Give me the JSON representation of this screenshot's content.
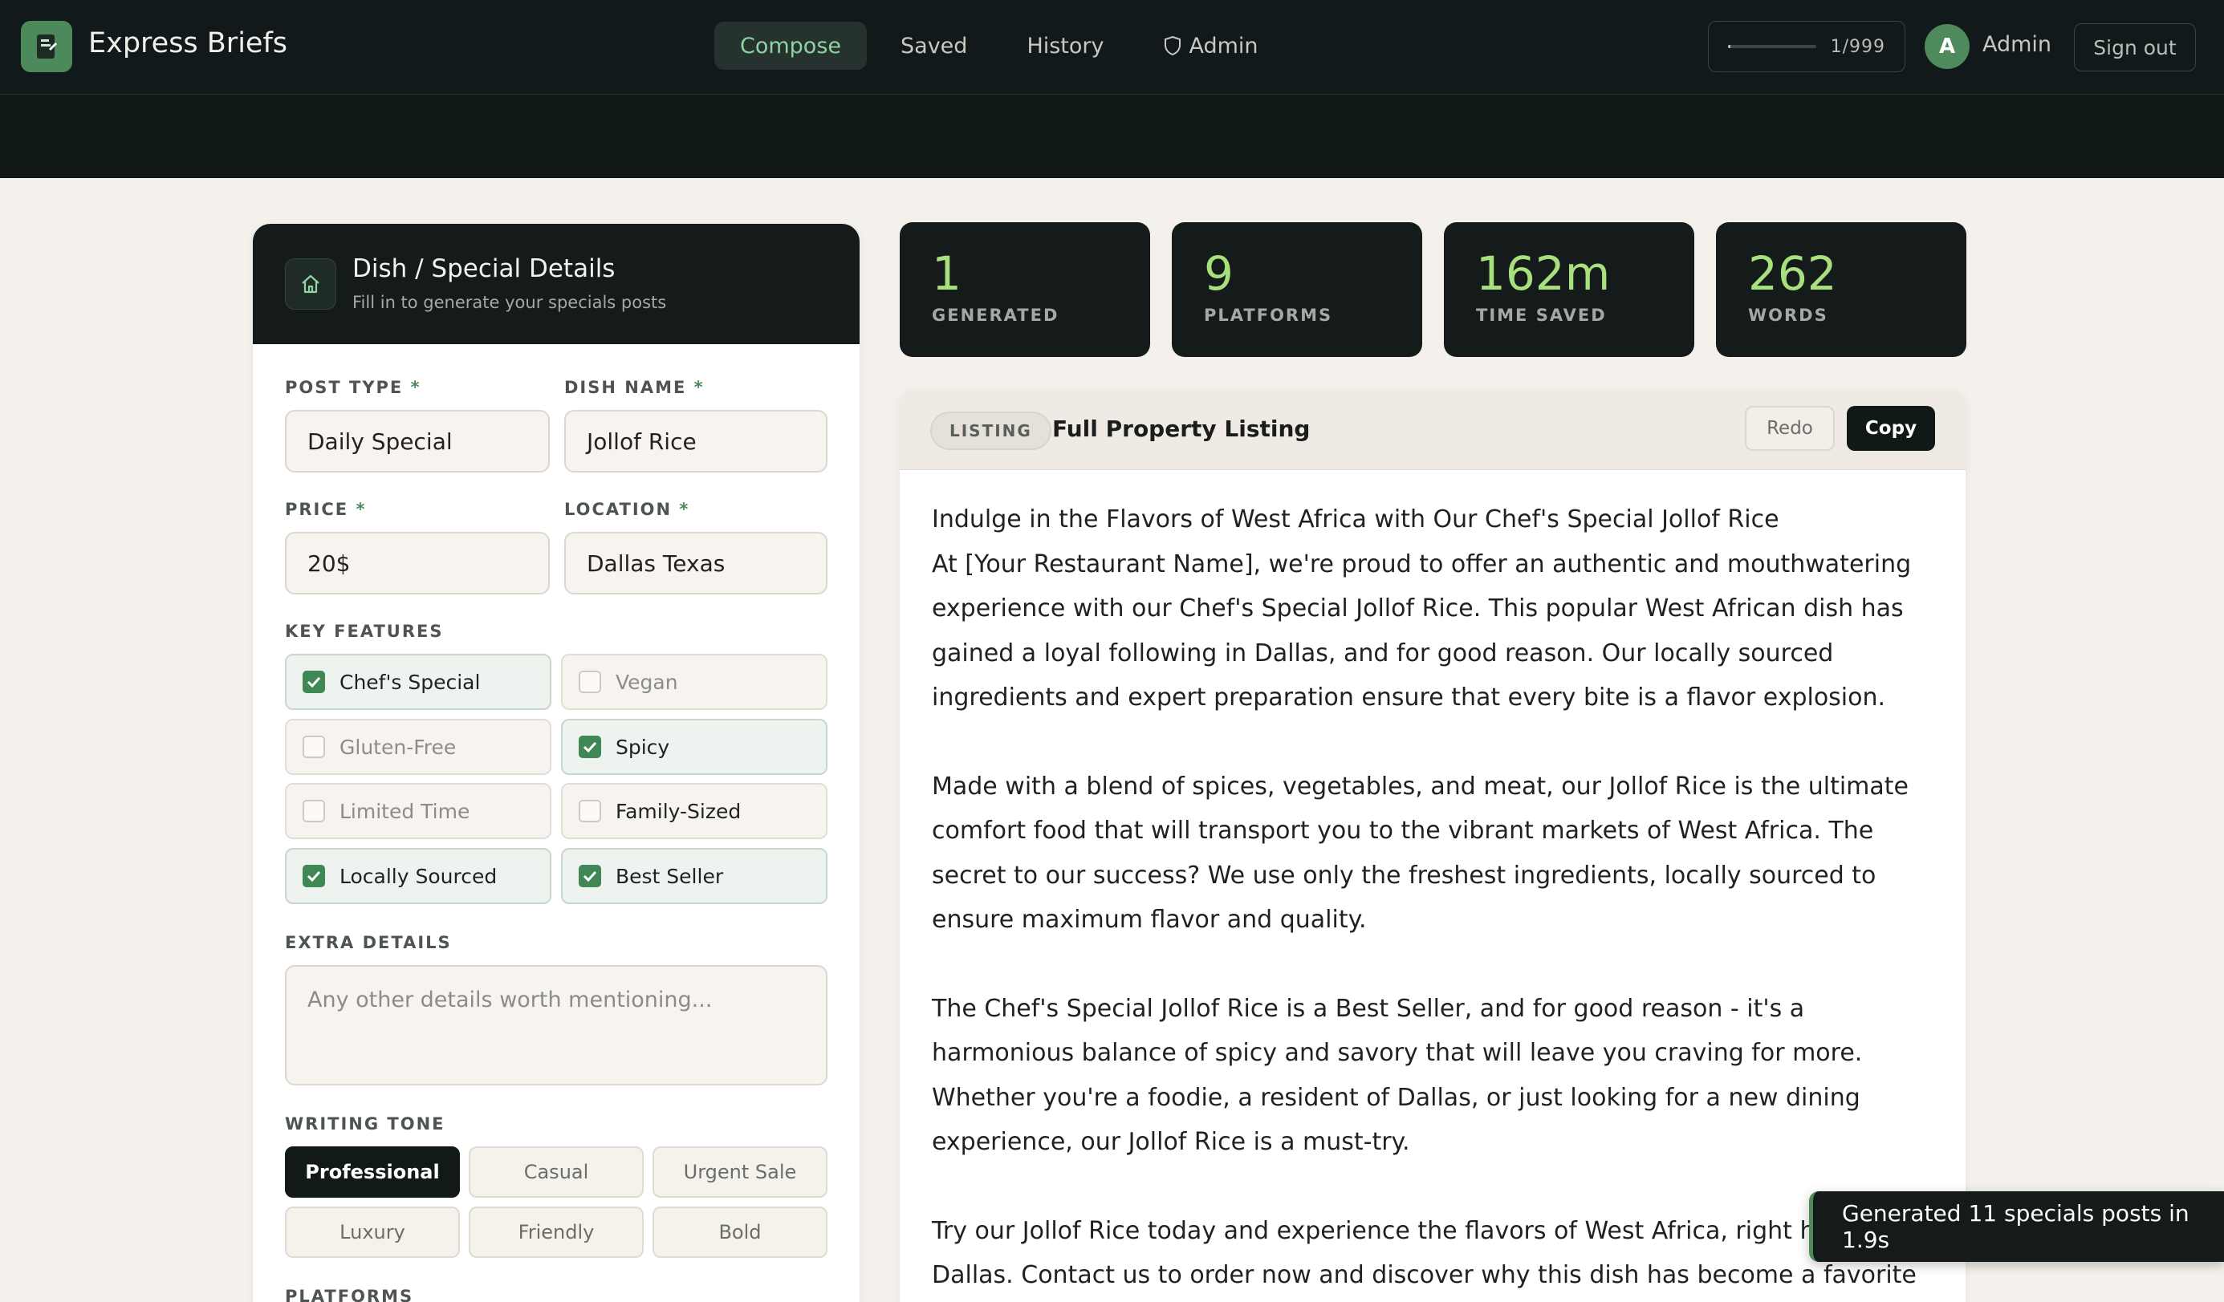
{
  "app": {
    "title": "Express Briefs"
  },
  "nav": {
    "tabs": [
      {
        "label": "Compose",
        "active": true
      },
      {
        "label": "Saved",
        "active": false
      },
      {
        "label": "History",
        "active": false
      },
      {
        "label": "Admin",
        "active": false,
        "icon": "shield-icon"
      }
    ]
  },
  "usage": {
    "text": "1/999",
    "fraction": 0.001
  },
  "user": {
    "initial": "A",
    "name": "Admin"
  },
  "signout_label": "Sign out",
  "form": {
    "title": "Dish / Special Details",
    "subtitle": "Fill in to generate your specials posts",
    "post_type": {
      "label": "POST TYPE",
      "required": "*",
      "value": "Daily Special"
    },
    "dish_name": {
      "label": "DISH NAME",
      "required": "*",
      "value": "Jollof Rice"
    },
    "price": {
      "label": "PRICE",
      "required": "*",
      "value": "20$"
    },
    "location": {
      "label": "LOCATION",
      "required": "*",
      "value": "Dallas Texas"
    },
    "features_label": "KEY FEATURES",
    "features": [
      {
        "label": "Chef's Special",
        "checked": true
      },
      {
        "label": "Vegan",
        "checked": false
      },
      {
        "label": "Gluten-Free",
        "checked": false
      },
      {
        "label": "Spicy",
        "checked": true
      },
      {
        "label": "Limited Time",
        "checked": false
      },
      {
        "label": "Family-Sized",
        "checked": false
      },
      {
        "label": "Locally Sourced",
        "checked": true
      },
      {
        "label": "Best Seller",
        "checked": true
      }
    ],
    "extra_label": "EXTRA DETAILS",
    "extra_placeholder": "Any other details worth mentioning...",
    "tone_label": "WRITING TONE",
    "tones": [
      {
        "label": "Professional",
        "active": true
      },
      {
        "label": "Casual",
        "active": false
      },
      {
        "label": "Urgent Sale",
        "active": false
      },
      {
        "label": "Luxury",
        "active": false
      },
      {
        "label": "Friendly",
        "active": false
      },
      {
        "label": "Bold",
        "active": false
      }
    ],
    "platforms_label": "PLATFORMS"
  },
  "stats": [
    {
      "value": "1",
      "label": "GENERATED"
    },
    {
      "value": "9",
      "label": "PLATFORMS"
    },
    {
      "value": "162m",
      "label": "TIME SAVED"
    },
    {
      "value": "262",
      "label": "WORDS"
    }
  ],
  "result": {
    "badge": "LISTING",
    "title": "Full Property Listing",
    "redo_label": "Redo",
    "copy_label": "Copy",
    "paragraphs": [
      "Indulge in the Flavors of West Africa with Our Chef's Special Jollof Rice\nAt [Your Restaurant Name], we're proud to offer an authentic and mouthwatering experience with our Chef's Special Jollof Rice. This popular West African dish has gained a loyal following in Dallas, and for good reason. Our locally sourced ingredients and expert preparation ensure that every bite is a flavor explosion.",
      "Made with a blend of spices, vegetables, and meat, our Jollof Rice is the ultimate comfort food that will transport you to the vibrant markets of West Africa. The secret to our success? We use only the freshest ingredients, locally sourced to ensure maximum flavor and quality.",
      "The Chef's Special Jollof Rice is a Best Seller, and for good reason - it's a harmonious balance of spicy and savory that will leave you craving for more. Whether you're a foodie, a resident of Dallas, or just looking for a new dining experience, our Jollof Rice is a must-try.",
      "Try our Jollof Rice today and experience the flavors of West Africa, right h\nDallas. Contact us to order now and discover why this dish has become a favorite"
    ]
  },
  "toast": {
    "text": "Generated 11 specials posts in 1.9s"
  },
  "colors": {
    "accent": "#4f8a5d",
    "stat_value": "#a7e07d",
    "dark": "#141b1a",
    "background": "#f4f1ec"
  }
}
